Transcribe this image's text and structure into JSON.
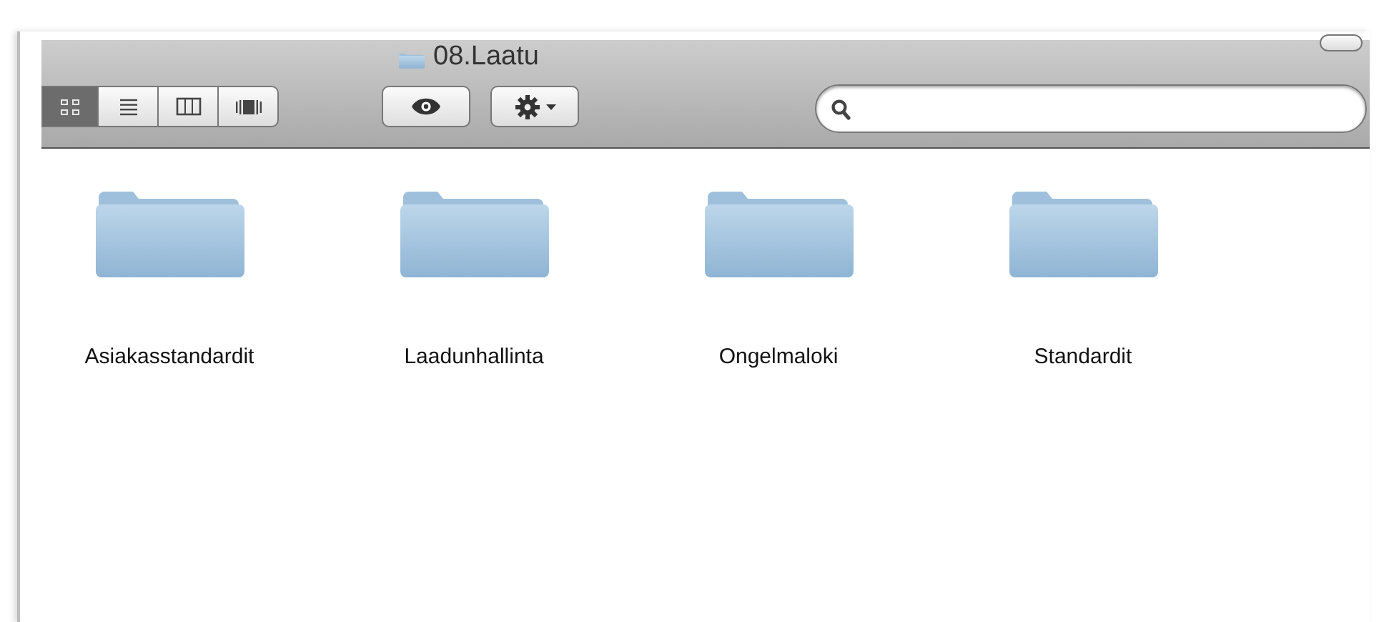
{
  "window": {
    "title": "08.Laatu"
  },
  "toolbar": {
    "view_buttons": [
      {
        "kind": "icons",
        "selected": true
      },
      {
        "kind": "list",
        "selected": false
      },
      {
        "kind": "columns",
        "selected": false
      },
      {
        "kind": "coverflow",
        "selected": false
      }
    ]
  },
  "items": [
    {
      "name": "Asiakasstandardit"
    },
    {
      "name": "Laadunhallinta"
    },
    {
      "name": "Ongelmaloki"
    },
    {
      "name": "Standardit"
    }
  ]
}
